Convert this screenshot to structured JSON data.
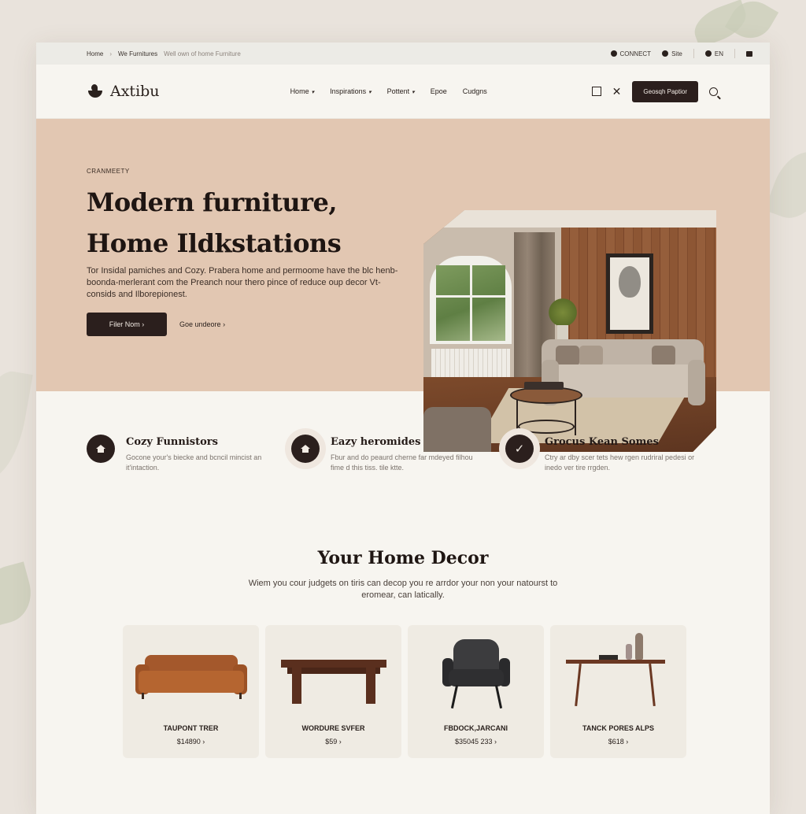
{
  "topbar": {
    "crumbs": [
      "Home",
      "We Furnitures"
    ],
    "crumb_extra": "Well own of home Furniture",
    "util": [
      "CONNECT",
      "Site",
      "EN"
    ]
  },
  "header": {
    "brand": "Axtibu",
    "nav": [
      "Home",
      "Inspirations",
      "Pottent",
      "Epoe",
      "Cudgns"
    ],
    "cta": "Geosqh Paptior"
  },
  "hero": {
    "eyebrow": "CRANMEETY",
    "title_line1": "Modern furniture,",
    "title_line2": "Home Ildkstations",
    "description": "Tor Insidal pamiches and Cozy. Prabera home and permoome have the blc henb-boonda-merlerant com the Preanch nour thero pince of reduce oup decor Vt-consids and Ilborepionest.",
    "primary_button": "Filer Nom",
    "secondary_link": "Goe undeore"
  },
  "features": [
    {
      "title": "Cozy Funnistors",
      "desc": "Gocone your's biecke and bcncil mincist an it'intaction."
    },
    {
      "title": "Eazy heromides",
      "desc": "Fbur and do peaurd cherne far mdeyed filhou fime d this tiss. tile ktte."
    },
    {
      "title": "Grocus Kean Somes",
      "desc": "Ctry ar dby scer tets hew rgen rudriral pedesi or inedo ver tire rrgden."
    }
  ],
  "decor": {
    "title": "Your Home Decor",
    "desc": "Wiem you cour judgets on tiris can decop you re arrdor your non your natourst to eromear, can latically."
  },
  "products": [
    {
      "name": "TAUPONT TRER",
      "price": "$14890"
    },
    {
      "name": "WORDURE SVFER",
      "price": "$59"
    },
    {
      "name": "FBDOCK,JARCANI",
      "price": "$35045 233"
    },
    {
      "name": "TANCK PORES ALPS",
      "price": "$618"
    }
  ]
}
